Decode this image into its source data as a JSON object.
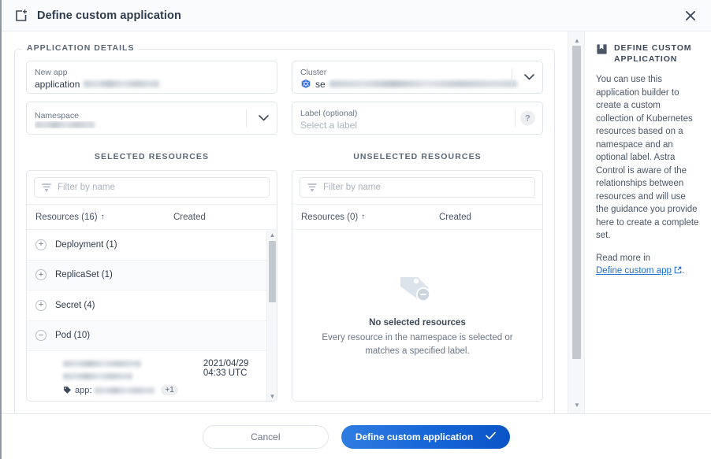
{
  "header": {
    "title": "Define custom application",
    "icon": "add-application-icon",
    "close_icon": "close-icon"
  },
  "section": {
    "legend": "APPLICATION DETAILS"
  },
  "form": {
    "new_app": {
      "label": "New app",
      "value_prefix": "application",
      "value_redacted": true
    },
    "cluster": {
      "label": "Cluster",
      "value_prefix": "se",
      "value_redacted": true,
      "icon": "kubernetes-icon",
      "chevron": "chevron-down-icon"
    },
    "namespace": {
      "label": "Namespace",
      "value_redacted": true,
      "chevron": "chevron-down-icon"
    },
    "label_field": {
      "label": "Label (optional)",
      "placeholder": "Select a label",
      "help_icon": "question-mark-icon"
    }
  },
  "panels": {
    "selected": {
      "title": "SELECTED RESOURCES",
      "filter_placeholder": "Filter by name",
      "filter_icon": "filter-icon",
      "columns": [
        "Resources (16)",
        "Created"
      ],
      "sort_indicator": "↑",
      "rows": [
        {
          "toggle": "+",
          "label": "Deployment (1)"
        },
        {
          "toggle": "+",
          "label": "ReplicaSet (1)"
        },
        {
          "toggle": "+",
          "label": "Secret (4)"
        },
        {
          "toggle": "−",
          "label": "Pod (10)"
        }
      ],
      "detail": {
        "created": "2021/04/29 04:33 UTC",
        "tag_icon": "tag-icon",
        "tag_key": "app:",
        "tag_more": "+1",
        "name_redacted": true
      }
    },
    "unselected": {
      "title": "UNSELECTED RESOURCES",
      "filter_placeholder": "Filter by name",
      "filter_icon": "filter-icon",
      "columns": [
        "Resources (0)",
        "Created"
      ],
      "sort_indicator": "↑",
      "empty": {
        "icon": "tag-minus-icon",
        "title": "No selected resources",
        "line1": "Every resource in the namespace is selected or",
        "line2": "matches a specified label."
      }
    }
  },
  "help": {
    "icon": "book-icon",
    "title": "DEFINE CUSTOM APPLICATION",
    "body": "You can use this application builder to create a custom collection of Kubernetes resources based on a namespace and an optional label. Astra Control is aware of the relationships between resources and will use the guidance you provide here to create a complete set.",
    "read_more": "Read more in",
    "link_text": "Define custom app",
    "link_icon": "external-link-icon",
    "link_suffix": "."
  },
  "footer": {
    "cancel_label": "Cancel",
    "submit_label": "Define custom application",
    "submit_icon": "check-icon"
  },
  "colors": {
    "accent": "#1565d8",
    "link": "#1a6fd4",
    "text": "#3c4858",
    "muted": "#6b7686",
    "border": "#e3e7ec",
    "kubernetes": "#326ce5"
  }
}
